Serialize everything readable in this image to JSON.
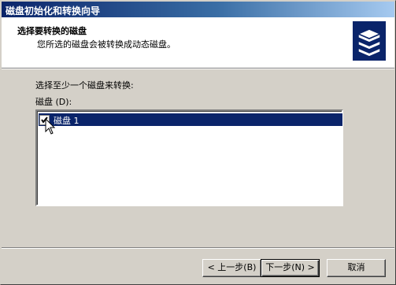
{
  "window": {
    "title": "磁盘初始化和转换向导"
  },
  "header": {
    "title": "选择要转换的磁盘",
    "subtitle": "您所选的磁盘会被转换成动态磁盘。",
    "icon": "disk-stack-icon"
  },
  "main": {
    "instruction": "选择至少一个磁盘来转换:",
    "disk_list_label": "磁盘 (D):",
    "disks": [
      {
        "label": "磁盘 1",
        "checked": true,
        "selected": true
      }
    ]
  },
  "buttons": {
    "back": "< 上一步(B)",
    "next": "下一步(N) >",
    "cancel": "取消"
  },
  "colors": {
    "title_bar": "#0a246a",
    "selection": "#0a246a",
    "face": "#d4d0c8",
    "header_icon": "#0a246a"
  }
}
